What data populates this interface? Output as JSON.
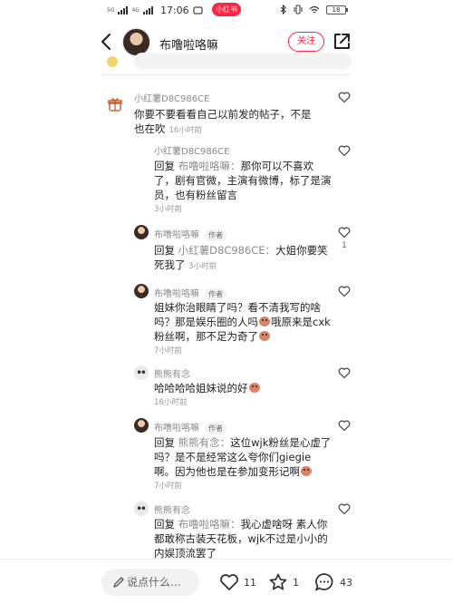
{
  "status_bar": {
    "signal_1": "5G",
    "signal_2": "4G",
    "time": "17:06",
    "app_pill": "小红书",
    "battery": "18"
  },
  "header": {
    "name": "布噜啦咯嘛",
    "follow_label": "关注"
  },
  "comments": [
    {
      "author": "小红薯D8C986CE",
      "text": "你要不要看看自己以前发的帖子，不是也在吹",
      "time": "16小时前"
    },
    {
      "author": "小红薯D8C986CE",
      "reply_prefix": "回复",
      "reply_to": "布噜啦咯嘛：",
      "text": "那你可以不喜欢了，剧有官微，主演有微博，标了是演员，也有粉丝留言",
      "time": "3小时前"
    },
    {
      "author": "布噜啦咯嘛",
      "tag": "作者",
      "reply_prefix": "回复",
      "reply_to": "小红薯D8C986CE：",
      "text": "大姐你要笑死我了",
      "time": "3小时前",
      "likes": "1"
    },
    {
      "author": "布噜啦咯嘛",
      "tag": "作者",
      "text_1": "姐妹你治眼睛了吗？看不清我写的啥吗？那是娱乐圈的人吗",
      "text_2": "哦原来是cxk粉丝啊，那不足为奇了",
      "time": "7小时前"
    },
    {
      "author": "熊熊有念",
      "text": "哈哈哈哈姐妹说的好",
      "time": "16小时前"
    },
    {
      "author": "布噜啦咯嘛",
      "tag": "作者",
      "reply_prefix": "回复",
      "reply_to": "熊熊有念：",
      "text": "这位wjk粉丝是心虚了吗？是不是经常这么夸你们giegie啊。因为他也是在参加变形记啊",
      "time": "7小时前"
    },
    {
      "author": "熊熊有念",
      "reply_prefix": "回复",
      "reply_to": "布噜啦咯嘛：",
      "text": "我心虚啥呀 素人你都敢称古装天花板，wjk不过是小小的内娱顶流罢了"
    }
  ],
  "bottom_bar": {
    "input_placeholder": "说点什么...",
    "likes": "11",
    "stars": "1",
    "comments": "43"
  },
  "colors": {
    "accent": "#ff2442",
    "secondary_text": "#8a8a8a"
  }
}
